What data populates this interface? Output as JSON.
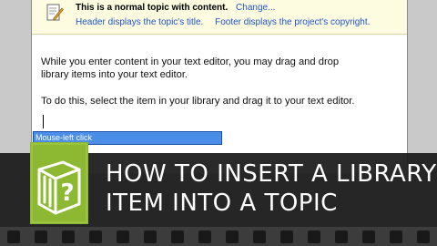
{
  "topic_header": {
    "title": "This is a normal topic with content.",
    "change_link": "Change...",
    "header_info": "Header displays the topic's title.",
    "footer_info": "Footer displays the project's copyright."
  },
  "editor": {
    "paragraph1_line1": "While you enter content in your text editor, you may drag and drop",
    "paragraph1_line2": "library items into your text editor.",
    "paragraph2": "To do this, select the item in your library and drag it to your text editor."
  },
  "tooltip": {
    "label": "Mouse-left click"
  },
  "video_title": {
    "line1": "HOW TO INSERT A LIBRARY",
    "line2": "ITEM INTO A TOPIC"
  },
  "colors": {
    "logo_green": "#8cb832",
    "overlay": "#1a1a1a",
    "link_blue": "#1f55c8",
    "tooltip_blue": "#4a8ee8"
  },
  "icons": {
    "topic": "document-pencil-icon",
    "logo": "help-book-icon"
  }
}
